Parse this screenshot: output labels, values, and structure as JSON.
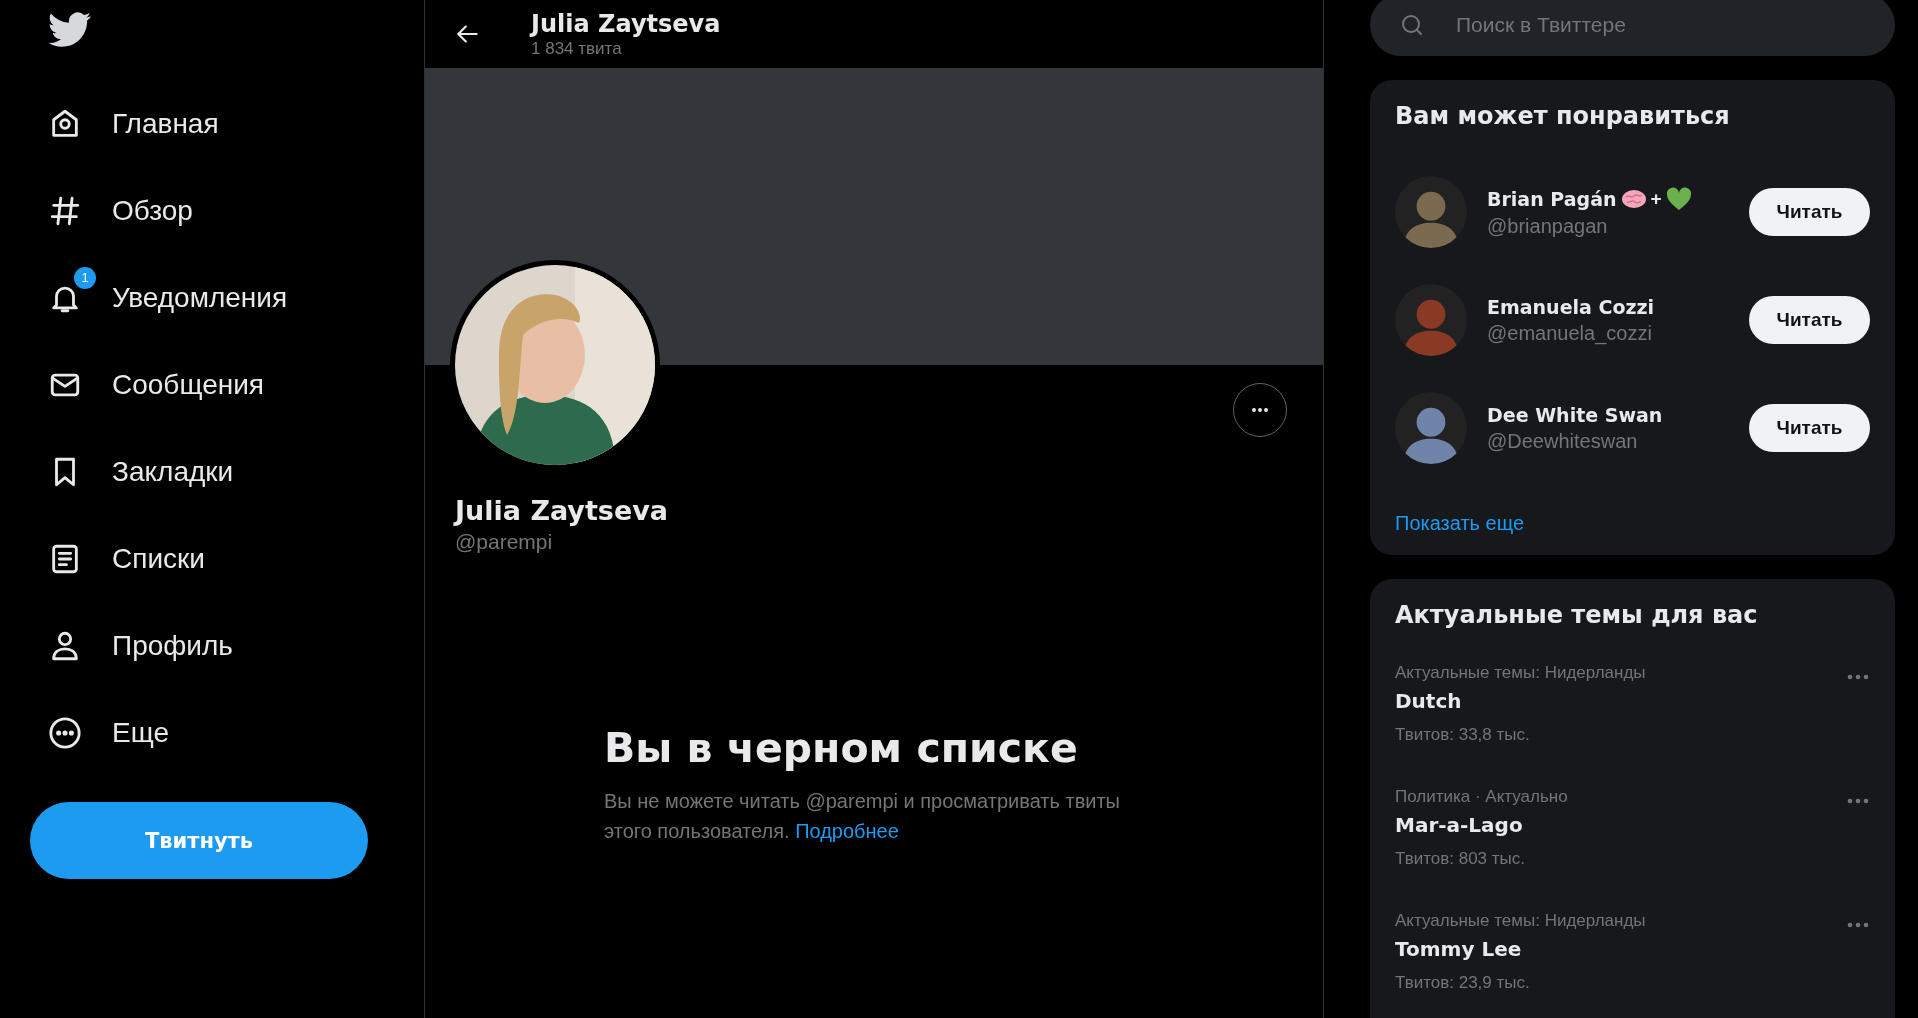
{
  "nav": {
    "items": [
      {
        "label": "Главная"
      },
      {
        "label": "Обзор"
      },
      {
        "label": "Уведомления",
        "badge": "1"
      },
      {
        "label": "Сообщения"
      },
      {
        "label": "Закладки"
      },
      {
        "label": "Списки"
      },
      {
        "label": "Профиль"
      },
      {
        "label": "Еще"
      }
    ],
    "tweet_button": "Твитнуть"
  },
  "header": {
    "title": "Julia Zaytseva",
    "subtitle": "1 834 твита"
  },
  "profile": {
    "name": "Julia Zaytseva",
    "handle": "@parempi"
  },
  "blocked": {
    "title": "Вы в черном списке",
    "text": "Вы не можете читать @parempi и просматривать твиты этого пользователя.",
    "link": "Подробнее"
  },
  "search": {
    "placeholder": "Поиск в Твиттере"
  },
  "suggestions": {
    "title": "Вам может понравиться",
    "more": "Показать еще",
    "people": [
      {
        "name": "Brian Pagán",
        "extras": [
          {
            "kind": "brain"
          },
          {
            "kind": "text",
            "text": "+"
          },
          {
            "kind": "heart"
          }
        ],
        "handle": "@brianpagan",
        "button": "Читать"
      },
      {
        "name": "Emanuela Cozzi",
        "handle": "@emanuela_cozzi",
        "button": "Читать"
      },
      {
        "name": "Dee White Swan",
        "handle": "@Deewhiteswan",
        "button": "Читать"
      }
    ]
  },
  "trends": {
    "title": "Актуальные темы для вас",
    "items": [
      {
        "context": "Актуальные темы: Нидерланды",
        "name": "Dutch",
        "count": "Твитов: 33,8 тыс."
      },
      {
        "context": "Политика · Актуально",
        "name": "Mar-a-Lago",
        "count": "Твитов: 803 тыс."
      },
      {
        "context": "Актуальные темы: Нидерланды",
        "name": "Tommy Lee",
        "count": "Твитов: 23,9 тыс."
      }
    ]
  }
}
